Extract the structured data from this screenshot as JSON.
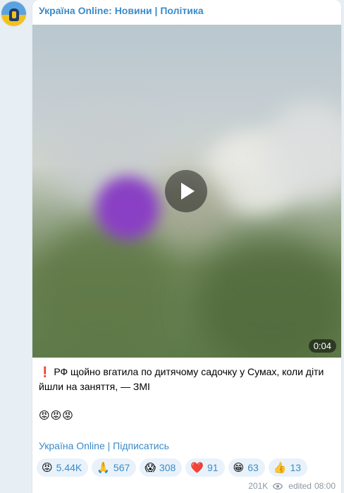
{
  "channel": {
    "name": "Україна Online: Новини | Політика"
  },
  "video": {
    "duration": "0:04"
  },
  "post": {
    "alert_emoji": "❗️",
    "text": "РФ щойно вгатила по дитячому садочку у Сумах, коли діти йшли на заняття, — ЗМІ",
    "emoji_line": "😡😡😡",
    "subscribe_link": "Україна Online | Підписатись"
  },
  "reactions": [
    {
      "icon": "angry-face",
      "emoji": "😡",
      "count": "5.44K"
    },
    {
      "icon": "folded-hands",
      "emoji": "🙏",
      "count": "567"
    },
    {
      "icon": "screaming-face",
      "emoji": "😱",
      "count": "308"
    },
    {
      "icon": "red-heart",
      "emoji": "❤️",
      "count": "91"
    },
    {
      "icon": "grinning-face",
      "emoji": "😁",
      "count": "63"
    },
    {
      "icon": "thumbs-up",
      "emoji": "👍",
      "count": "13"
    }
  ],
  "meta": {
    "views": "201K",
    "edited_label": "edited",
    "time": "08:00"
  },
  "colors": {
    "link": "#3a8bc9",
    "background": "#e7eef4",
    "reaction_bg": "#e9f2fa",
    "meta": "#8c97a3"
  }
}
